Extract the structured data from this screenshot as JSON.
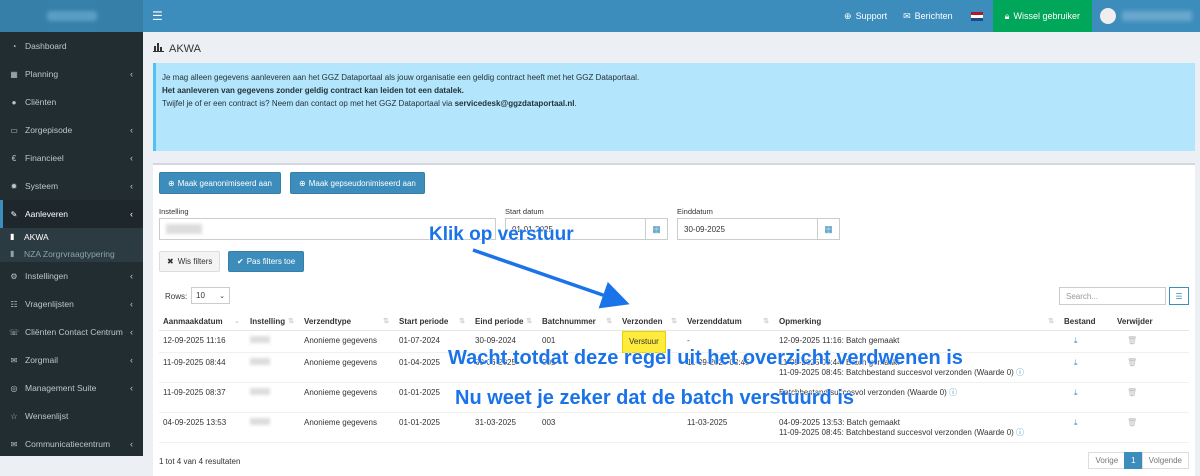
{
  "header": {
    "support": "Support",
    "messages": "Berichten",
    "switch_user": "Wissel gebruiker"
  },
  "sidebar": {
    "items": [
      {
        "label": "Dashboard",
        "icon": "dashboard-icon",
        "chevron": false
      },
      {
        "label": "Planning",
        "icon": "calendar-icon",
        "chevron": true
      },
      {
        "label": "Cliënten",
        "icon": "user-icon",
        "chevron": false
      },
      {
        "label": "Zorgepisode",
        "icon": "folder-icon",
        "chevron": true
      },
      {
        "label": "Financieel",
        "icon": "euro-icon",
        "chevron": true
      },
      {
        "label": "Systeem",
        "icon": "gear-icon",
        "chevron": true
      },
      {
        "label": "Aanleveren",
        "icon": "wrench-icon",
        "chevron": true,
        "active": true
      }
    ],
    "subitems": [
      {
        "label": "AKWA",
        "icon": "chart-icon",
        "active": true
      },
      {
        "label": "NZA Zorgrvraagtypering",
        "icon": "chart-icon",
        "active": false
      }
    ],
    "items2": [
      {
        "label": "Instellingen",
        "icon": "settings-icon",
        "chevron": true
      },
      {
        "label": "Vragenlijsten",
        "icon": "list-icon",
        "chevron": true
      },
      {
        "label": "Cliënten Contact Centrum",
        "icon": "phone-icon",
        "chevron": true
      },
      {
        "label": "Zorgmail",
        "icon": "mail-icon",
        "chevron": true
      },
      {
        "label": "Management Suite",
        "icon": "bullseye-icon",
        "chevron": true
      },
      {
        "label": "Wensenlijst",
        "icon": "star-icon",
        "chevron": false
      },
      {
        "label": "Communicatiecentrum",
        "icon": "mail-icon",
        "chevron": true
      }
    ]
  },
  "page": {
    "title": "AKWA",
    "alert_line1": "Je mag alleen gegevens aanleveren aan het GGZ Dataportaal als jouw organisatie een geldig contract heeft met het GGZ Dataportaal.",
    "alert_line2": "Het aanleveren van gegevens zonder geldig contract kan leiden tot een datalek.",
    "alert_line3_prefix": "Twijfel je of er een contract is? Neem dan contact op met het GGZ Dataportaal via ",
    "alert_email": "servicedesk@ggzdataportaal.nl",
    "alert_line3_suffix": "."
  },
  "actions": {
    "anon": "Maak geanonimiseerd aan",
    "pseudo": "Maak gepseudonimiseerd aan",
    "clear": "Wis filters",
    "apply": "Pas filters toe"
  },
  "filters": {
    "instelling_label": "Instelling",
    "start_label": "Start datum",
    "start_value": "01-01-2025",
    "end_label": "Einddatum",
    "end_value": "30-09-2025"
  },
  "table": {
    "rows_label": "Rows:",
    "rows_value": "10",
    "search_placeholder": "Search...",
    "headers": [
      "Aanmaakdatum",
      "Instelling",
      "Verzendtype",
      "Start periode",
      "Eind periode",
      "Batchnummer",
      "Verzonden",
      "Verzenddatum",
      "Opmerking",
      "Bestand",
      "Verwijder"
    ],
    "rows": [
      {
        "aanmaak": "12-09-2025 11:16",
        "type": "Anonieme gegevens",
        "start": "01-07-2024",
        "eind": "30-09-2024",
        "batch": "001",
        "verzonden": "Verstuur",
        "datum": "-",
        "opm1": "12-09-2025 11:16: Batch gemaakt",
        "opm2": ""
      },
      {
        "aanmaak": "11-09-2025 08:44",
        "type": "Anonieme gegevens",
        "start": "01-04-2025",
        "eind": "30-06-2025",
        "batch": "001",
        "verzonden": "",
        "datum": "11-09-2025 08:45",
        "opm1": "11-09-2025 08:44: Batch gemaakt",
        "opm2": "11-09-2025 08:45: Batchbestand succesvol verzonden (Waarde 0)"
      },
      {
        "aanmaak": "11-09-2025 08:37",
        "type": "Anonieme gegevens",
        "start": "01-01-2025",
        "eind": "",
        "batch": "",
        "verzonden": "",
        "datum": "",
        "opm1": "",
        "opm2": "Batchbestand succesvol verzonden (Waarde 0)"
      },
      {
        "aanmaak": "04-09-2025 13:53",
        "type": "Anonieme gegevens",
        "start": "01-01-2025",
        "eind": "31-03-2025",
        "batch": "003",
        "verzonden": "",
        "datum": "11-03-2025",
        "opm1": "04-09-2025 13:53: Batch gemaakt",
        "opm2": "11-09-2025 08:45: Batchbestand succesvol verzonden (Waarde 0)"
      }
    ],
    "footer": "1 tot 4 van 4 resultaten",
    "prev": "Vorige",
    "page": "1",
    "next": "Volgende"
  },
  "annotations": {
    "click": "Klik op verstuur",
    "wait": "Wacht totdat deze regel uit het overzicht verdwenen is",
    "now": "Nu weet je zeker dat de batch verstuurd is"
  }
}
